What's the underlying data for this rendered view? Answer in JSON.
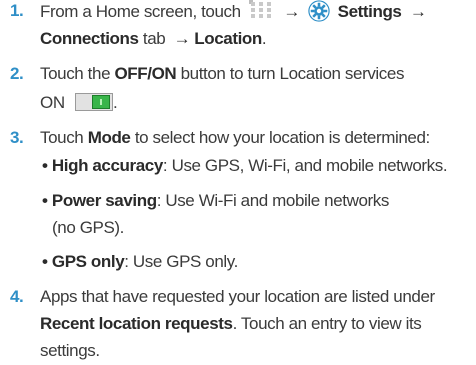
{
  "steps": [
    {
      "number": "1.",
      "text_1": "From a Home screen, touch",
      "arrow_1": "→",
      "settings_label": "Settings",
      "arrow_2": "→",
      "connections_label": "Connections",
      "tab_word": "tab",
      "arrow_3": "→",
      "location_label": "Location",
      "period": "."
    },
    {
      "number": "2.",
      "text_1": "Touch the",
      "offon_label": "OFF/ON",
      "text_2": "button to turn Location services",
      "text_3": "ON",
      "period": "."
    },
    {
      "number": "3.",
      "text_1": "Touch",
      "mode_label": "Mode",
      "text_2": "to select how your location is determined:",
      "options": [
        {
          "bullet": "•",
          "label": "High accuracy",
          "desc": ": Use GPS, Wi-Fi, and mobile networks."
        },
        {
          "bullet": "•",
          "label": "Power saving",
          "desc": ": Use Wi-Fi and mobile networks",
          "desc_2": "(no GPS)."
        },
        {
          "bullet": "•",
          "label": "GPS only",
          "desc": ": Use GPS only."
        }
      ]
    },
    {
      "number": "4.",
      "text_1": "Apps that have requested your location are listed under",
      "recent_label": "Recent location requests",
      "text_2": ". Touch an entry to view its",
      "text_3": "settings."
    }
  ],
  "icons": {
    "apps": "apps-grid-icon",
    "settings": "settings-gear-icon",
    "toggle": "on-toggle-icon"
  },
  "colors": {
    "step_number": "#2f8fc7",
    "toggle_on": "#39b54a",
    "gear": "#2f8fc7"
  },
  "toggle_state": "on"
}
